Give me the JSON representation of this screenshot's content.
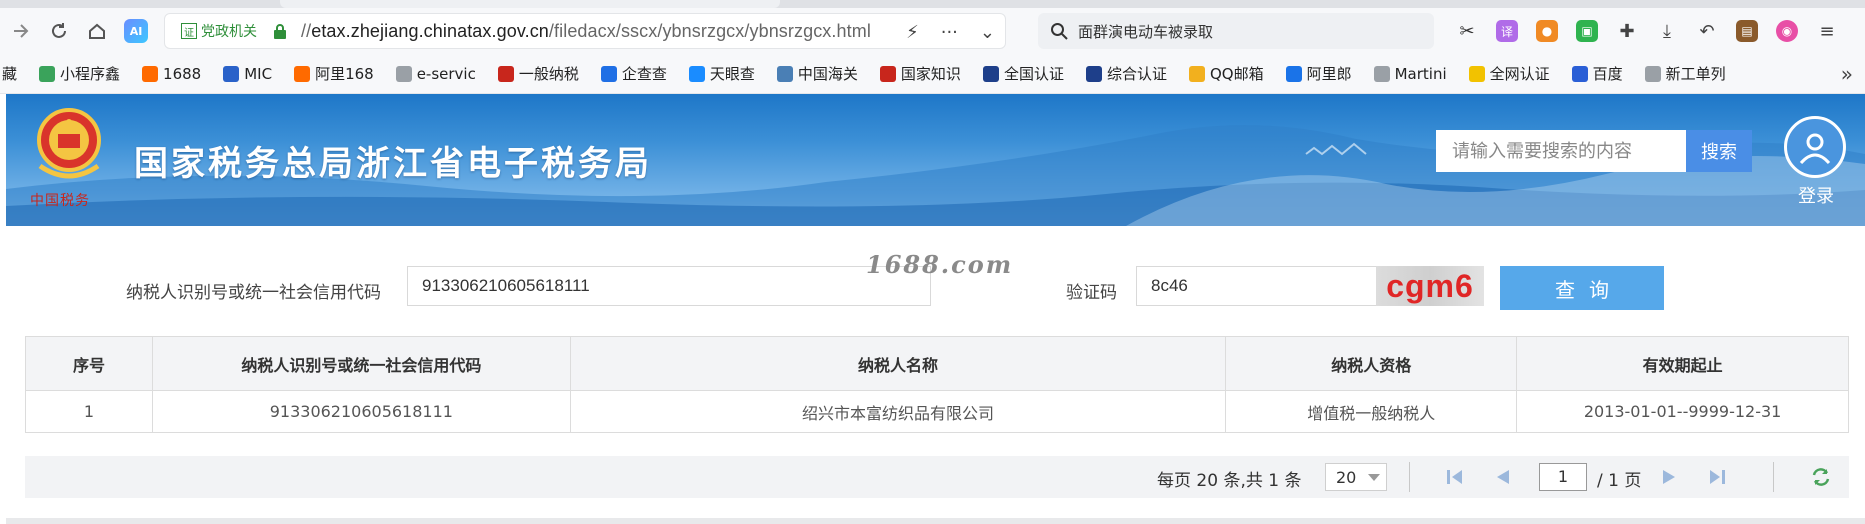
{
  "browser": {
    "gov_badge": "党政机关",
    "url_protocol": "//",
    "url_host": "etax.zhejiang.chinatax.gov.cn",
    "url_path": "/filedacx/sscx/ybnsrzgcx/ybnsrzgcx.html",
    "search_text": "面群演电动车被录取",
    "ai_label": "AI",
    "bookmarks": [
      {
        "label": "藏",
        "color": "#888888"
      },
      {
        "label": "小程序鑫",
        "color": "#3aa35b"
      },
      {
        "label": "1688",
        "color": "#ff6a00"
      },
      {
        "label": "MIC",
        "color": "#2a62c9"
      },
      {
        "label": "阿里168",
        "color": "#ff6a00"
      },
      {
        "label": "e-servic",
        "color": "#9aa0a6"
      },
      {
        "label": "一般纳税",
        "color": "#c8261c"
      },
      {
        "label": "企查查",
        "color": "#1f6fe5"
      },
      {
        "label": "天眼查",
        "color": "#1a8cff"
      },
      {
        "label": "中国海关",
        "color": "#4a7fb5"
      },
      {
        "label": "国家知识",
        "color": "#c8261c"
      },
      {
        "label": "全国认证",
        "color": "#1e3f8a"
      },
      {
        "label": "综合认证",
        "color": "#1e3f8a"
      },
      {
        "label": "QQ邮箱",
        "color": "#f2b01e"
      },
      {
        "label": "阿里郎",
        "color": "#1a73e8"
      },
      {
        "label": "Martini",
        "color": "#9aa0a6"
      },
      {
        "label": "全网认证",
        "color": "#f2c200"
      },
      {
        "label": "百度",
        "color": "#2a5fd6"
      },
      {
        "label": "新工单列",
        "color": "#9aa0a6"
      }
    ]
  },
  "site": {
    "title": "国家税务总局浙江省电子税务局",
    "emblem_caption": "中国税务",
    "search_placeholder": "请输入需要搜索的内容",
    "search_button": "搜索",
    "login_label": "登录"
  },
  "form": {
    "taxid_label": "纳税人识别号或统一社会信用代码",
    "taxid_value": "913306210605618111",
    "watermark": "1688.com",
    "code_label": "验证码",
    "code_value": "8c46",
    "captcha_text": "cgm6",
    "query_button": "查询"
  },
  "table": {
    "headers": [
      "序号",
      "纳税人识别号或统一社会信用代码",
      "纳税人名称",
      "纳税人资格",
      "有效期起止"
    ],
    "rows": [
      [
        "1",
        "913306210605618111",
        "绍兴市本富纺织品有限公司",
        "增值税一般纳税人",
        "2013-01-01--9999-12-31"
      ]
    ]
  },
  "pager": {
    "summary": "每页 20 条,共 1 条",
    "page_size": "20",
    "current_page": "1",
    "total_pages": "/ 1 页"
  },
  "colors": {
    "accent": "#4a8ee6",
    "query_button": "#56a8ea",
    "captcha_text": "#e02626"
  }
}
